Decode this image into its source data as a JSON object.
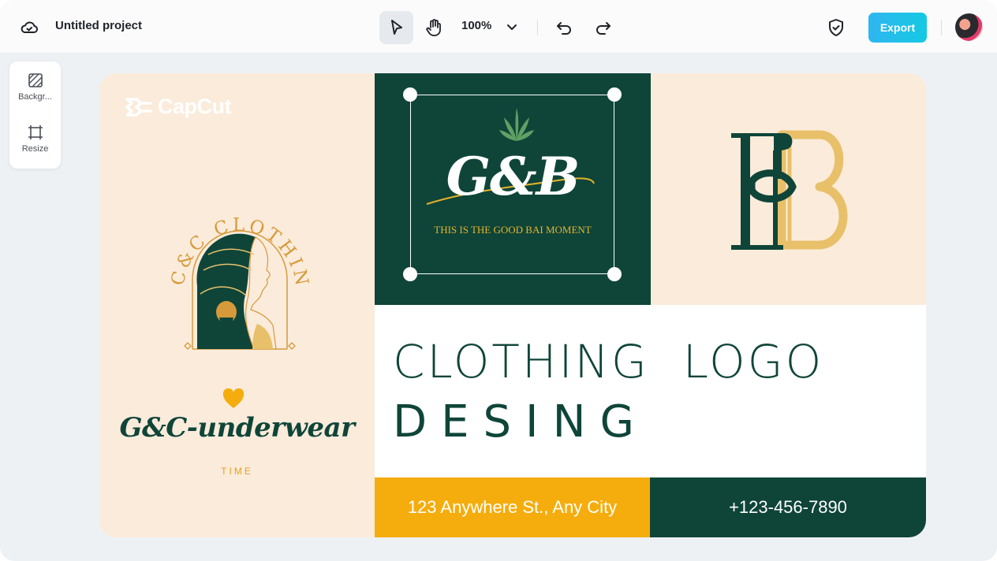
{
  "topbar": {
    "project_title": "Untitled project",
    "zoom": "100%",
    "export_label": "Export"
  },
  "side_panel": {
    "items": [
      {
        "label": "Backgr...",
        "icon": "background-icon"
      },
      {
        "label": "Resize",
        "icon": "resize-icon"
      }
    ]
  },
  "design": {
    "capcut_logo_text": "CapCut",
    "emblem_text": "C&C CLOTHING",
    "brand_name": "G&C-underwear",
    "brand_sub": "TIME",
    "gb_logo": "G&B",
    "gb_tagline": "THIS IS THE GOOD BAI MOMENT",
    "title_line1": "CLOTHING  LOGO",
    "title_line2": "DESING",
    "address": "123 Anywhere St., Any City",
    "phone": "+123-456-7890"
  },
  "colors": {
    "dark_green": "#0f4539",
    "cream": "#fbebdb",
    "gold": "#f5ad0d",
    "export_gradient": [
      "#2fb6f0",
      "#14c9e2"
    ]
  }
}
